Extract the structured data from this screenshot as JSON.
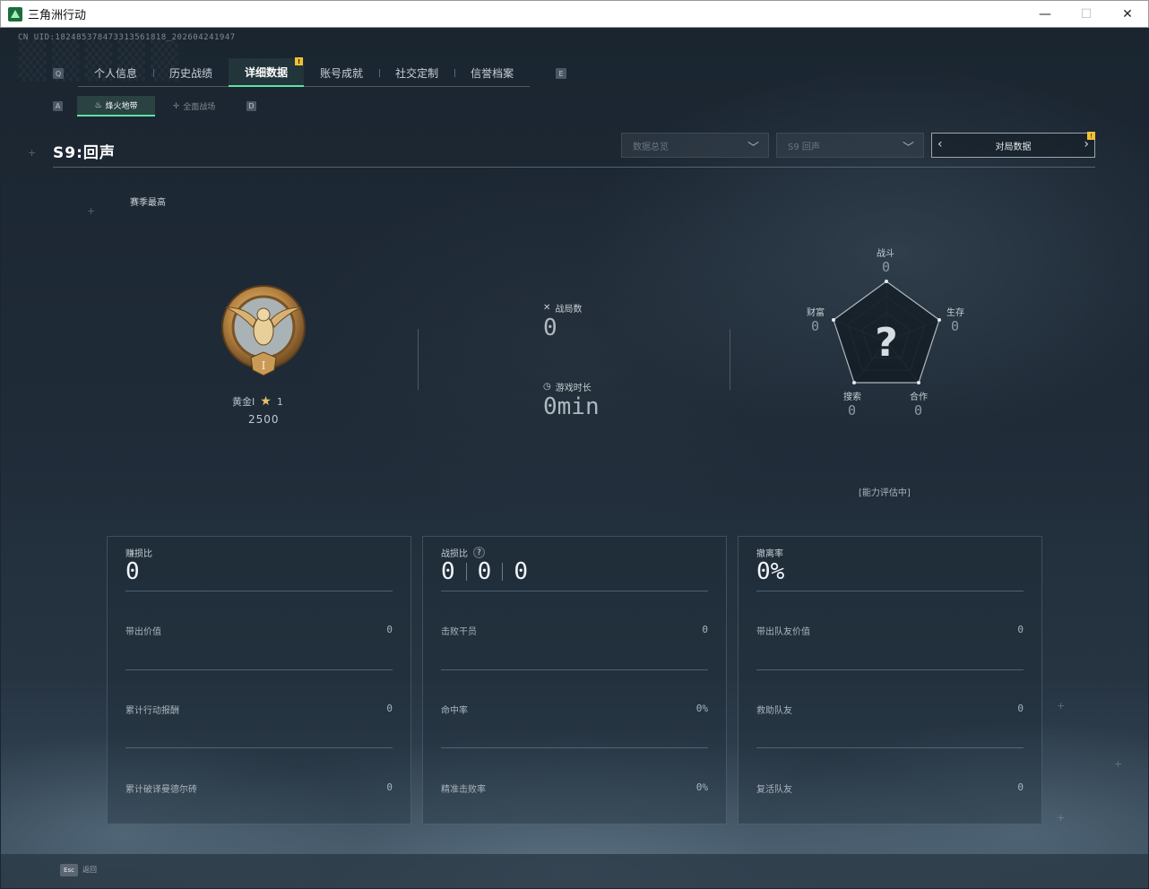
{
  "window": {
    "title": "三角洲行动",
    "controls": [
      "—",
      "☐",
      "✕"
    ]
  },
  "uid": "CN UID:18248537847331356181​8_202604241947",
  "hints": {
    "tab_prev": "Q",
    "tab_next": "E",
    "sub_prev": "A",
    "sub_next": "D",
    "esc_key": "Esc",
    "esc_label": "返回"
  },
  "tabs": [
    {
      "label": "个人信息"
    },
    {
      "label": "历史战绩"
    },
    {
      "label": "详细数据",
      "active": true,
      "badge": "!"
    },
    {
      "label": "账号成就"
    },
    {
      "label": "社交定制"
    },
    {
      "label": "信誉档案"
    }
  ],
  "subtabs": [
    {
      "label": "烽火地带",
      "active": true
    },
    {
      "label": "全面战场"
    }
  ],
  "season": {
    "title": "S9:回声",
    "best_label": "赛季最高"
  },
  "filters": {
    "data_dropdown": "数据总览",
    "season_dropdown": "S9 回声",
    "match_button": "对局数据",
    "match_badge": "!"
  },
  "rank": {
    "name": "黄金I",
    "stars": "1",
    "score": "2500"
  },
  "matches": {
    "label": "战局数",
    "value": "0"
  },
  "playtime": {
    "label": "游戏时长",
    "value": "0min"
  },
  "radar": {
    "center": "?",
    "axes": [
      {
        "label": "战斗",
        "value": "0"
      },
      {
        "label": "生存",
        "value": "0"
      },
      {
        "label": "合作",
        "value": "0"
      },
      {
        "label": "搜索",
        "value": "0"
      },
      {
        "label": "财富",
        "value": "0"
      }
    ],
    "status": "[能力评估中]"
  },
  "cards": [
    {
      "title": "赚损比",
      "big": [
        "0"
      ],
      "rows": [
        {
          "label": "带出价值",
          "value": "0"
        },
        {
          "label": "累计行动报酬",
          "value": "0"
        },
        {
          "label": "累计破译曼德尔砖",
          "value": "0"
        }
      ]
    },
    {
      "title": "战损比",
      "help": "?",
      "big": [
        "0",
        "0",
        "0"
      ],
      "rows": [
        {
          "label": "击败干员",
          "value": "0"
        },
        {
          "label": "命中率",
          "value": "0%"
        },
        {
          "label": "精准击败率",
          "value": "0%"
        }
      ]
    },
    {
      "title": "撤离率",
      "big": [
        "0%"
      ],
      "rows": [
        {
          "label": "带出队友价值",
          "value": "0"
        },
        {
          "label": "救助队友",
          "value": "0"
        },
        {
          "label": "复活队友",
          "value": "0"
        }
      ]
    }
  ],
  "colors": {
    "accent": "#5fe3a1",
    "badge": "#f2c132",
    "gold": "#c89a52"
  },
  "icons": [
    "app-icon",
    "crossed-swords-icon",
    "stopwatch-icon",
    "star-icon",
    "chevron-down-icon",
    "chevron-left-icon",
    "chevron-right-icon",
    "rank-emblem-icon",
    "campfire-icon",
    "battlefield-icon"
  ]
}
